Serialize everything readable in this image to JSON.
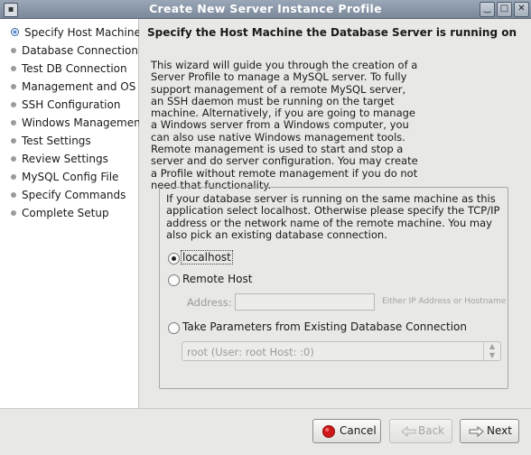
{
  "window": {
    "title": "Create New Server Instance Profile",
    "minimize_glyph": "‿",
    "maximize_glyph": "□",
    "close_glyph": "✕"
  },
  "sidebar": {
    "items": [
      {
        "label": "Specify Host Machine",
        "current": true
      },
      {
        "label": "Database Connection"
      },
      {
        "label": "Test DB Connection"
      },
      {
        "label": "Management and OS"
      },
      {
        "label": "SSH Configuration"
      },
      {
        "label": "Windows Management"
      },
      {
        "label": "Test Settings"
      },
      {
        "label": "Review Settings"
      },
      {
        "label": "MySQL Config File"
      },
      {
        "label": "Specify Commands"
      },
      {
        "label": "Complete Setup"
      }
    ]
  },
  "main": {
    "heading": "Specify the Host Machine the Database Server is running on",
    "intro": "This wizard will guide you through the creation of a Server Profile to manage a MySQL server. To fully support management of a remote MySQL server, an SSH daemon must be running on the target machine. Alternatively, if you are going to manage a Windows server from a Windows computer, you can also use native Windows management tools. Remote management is used to start and stop a server and do server configuration. You may create a Profile without remote management if you do not need that functionality.",
    "group": {
      "description": "If your database server is running on the same machine as this application select localhost. Otherwise please specify the TCP/IP address or the network name of the remote machine. You may also pick an existing database connection.",
      "options": {
        "localhost": "localhost",
        "remote": "Remote Host",
        "existing": "Take Parameters from Existing Database Connection"
      },
      "selected": "localhost",
      "address_label": "Address:",
      "address_value": "",
      "address_hint": "Either IP Address or Hostname",
      "connection_value": "root (User: root  Host: :0)"
    }
  },
  "footer": {
    "cancel": "Cancel",
    "back": "Back",
    "next": "Next"
  },
  "colors": {
    "titlebar": "#8b97a8",
    "sidebar_bg": "#ffffff",
    "window_bg": "#e8e8e6",
    "cancel_icon": "#d01818"
  }
}
